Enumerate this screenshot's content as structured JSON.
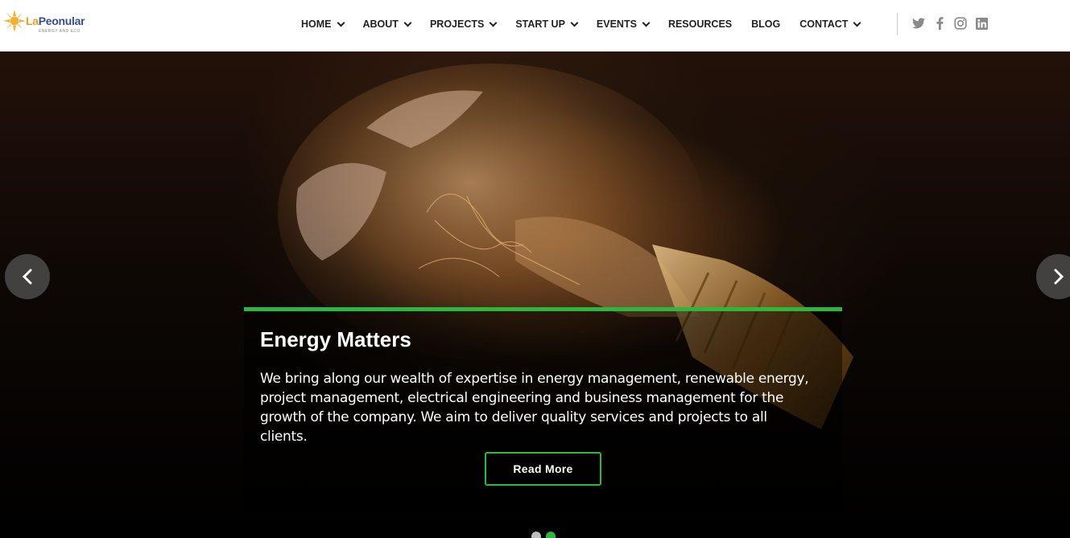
{
  "brand": {
    "name_prefix": "La",
    "name_suffix": "Peonular",
    "tagline": "ENERGY AND ECO"
  },
  "nav": {
    "items": [
      {
        "label": "HOME",
        "dropdown": true
      },
      {
        "label": "ABOUT",
        "dropdown": true
      },
      {
        "label": "PROJECTS",
        "dropdown": true
      },
      {
        "label": "START UP",
        "dropdown": true
      },
      {
        "label": "EVENTS",
        "dropdown": true
      },
      {
        "label": "RESOURCES",
        "dropdown": false
      },
      {
        "label": "BLOG",
        "dropdown": false
      },
      {
        "label": "CONTACT",
        "dropdown": true
      }
    ]
  },
  "social": [
    "twitter-icon",
    "facebook-icon",
    "instagram-icon",
    "linkedin-icon"
  ],
  "slide": {
    "title": "Energy Matters",
    "text": "We bring along our wealth of expertise in energy management, renewable energy, project management, electrical engineering and business management for the growth of the company. We aim to deliver quality services and projects to all clients.",
    "button": "Read More"
  },
  "slider": {
    "slide_count": 2,
    "active_index": 1
  },
  "colors": {
    "accent": "#2db83d",
    "logo_sun": "#f2b233",
    "logo_text": "#3b4c8c"
  }
}
